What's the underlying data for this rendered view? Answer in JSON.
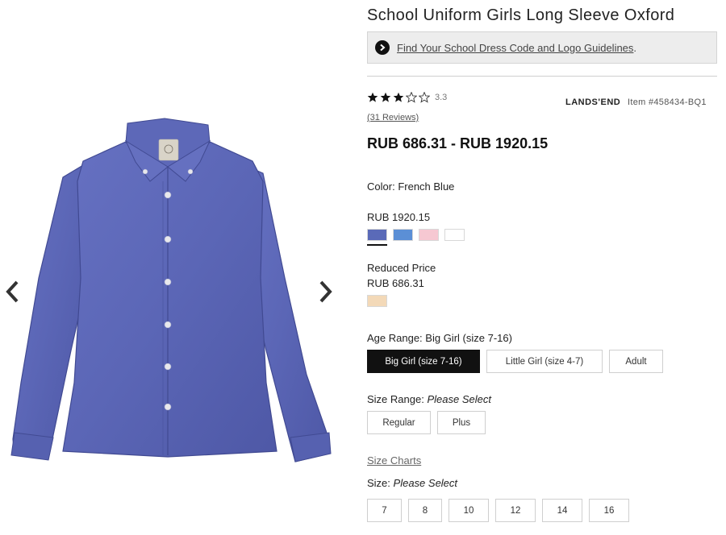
{
  "gallery": {
    "prev_icon": "chevron-left-icon",
    "next_icon": "chevron-right-icon",
    "image_description": "long sleeve oxford shirt, french blue"
  },
  "product": {
    "title": "School Uniform Girls Long Sleeve Oxford",
    "guide_link": "Find Your School Dress Code and Logo Guidelines",
    "guide_link_period": ".",
    "rating": "3.3",
    "stars_filled": 3,
    "stars_total": 5,
    "reviews": "(31 Reviews)",
    "brand": "LANDS'END",
    "item_number": "Item #458434-BQ1",
    "price_range": "RUB 686.31 - RUB 1920.15"
  },
  "color": {
    "label": "Color:",
    "value": "French Blue",
    "regular_price": "RUB 1920.15",
    "regular_swatches": [
      {
        "name": "French Blue",
        "hex": "#5a6ab8",
        "selected": true
      },
      {
        "name": "Blue",
        "hex": "#5b8fd6",
        "selected": false
      },
      {
        "name": "Pink",
        "hex": "#f6c8d2",
        "selected": false
      },
      {
        "name": "White",
        "hex": "#ffffff",
        "selected": false
      }
    ],
    "reduced_label": "Reduced Price",
    "reduced_price": "RUB 686.31",
    "reduced_swatches": [
      {
        "name": "Tan",
        "hex": "#f3d9b8",
        "selected": false
      }
    ]
  },
  "age_range": {
    "label": "Age Range:",
    "value": "Big Girl (size 7-16)",
    "options": [
      "Big Girl (size 7-16)",
      "Little Girl (size 4-7)",
      "Adult"
    ],
    "active_index": 0
  },
  "size_range": {
    "label": "Size Range:",
    "value": "Please Select",
    "options": [
      "Regular",
      "Plus"
    ]
  },
  "size_chart_link": "Size Charts",
  "size": {
    "label": "Size:",
    "value": "Please Select",
    "options": [
      "7",
      "8",
      "10",
      "12",
      "14",
      "16"
    ]
  }
}
